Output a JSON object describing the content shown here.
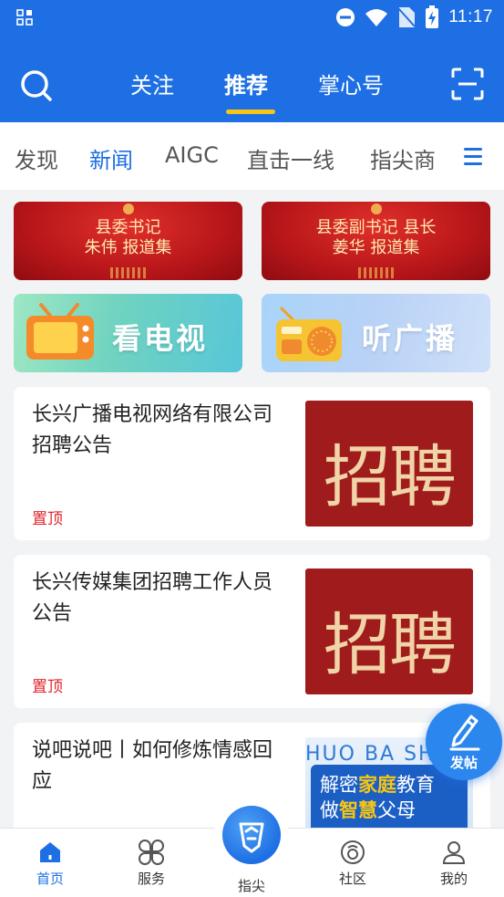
{
  "status_bar": {
    "time": "11:17"
  },
  "top_tabs": [
    {
      "label": "关注"
    },
    {
      "label": "推荐",
      "active": true
    },
    {
      "label": "掌心号"
    }
  ],
  "channels": [
    {
      "label": "发现"
    },
    {
      "label": "新闻",
      "active": true
    },
    {
      "label": "AIGC"
    },
    {
      "label": "直击一线"
    },
    {
      "label": "指尖商"
    }
  ],
  "banners": {
    "secretary": {
      "line1": "县委书记",
      "line2": "朱伟 报道集"
    },
    "deputy": {
      "line1": "县委副书记 县长",
      "line2": "姜华 报道集"
    },
    "tv": {
      "label": "看电视"
    },
    "radio": {
      "label": "听广播"
    }
  },
  "articles": [
    {
      "title": "长兴广播电视网络有限公司招聘公告",
      "tag": "置顶",
      "thumb_text": "招聘"
    },
    {
      "title": "长兴传媒集团招聘工作人员公告",
      "tag": "置顶",
      "thumb_text": "招聘"
    },
    {
      "title": "说吧说吧丨如何修炼情感回应",
      "thumb_header": "HUO BA SHU",
      "thumb_poster_a": "解密",
      "thumb_poster_b": "家庭",
      "thumb_poster_c": "教育",
      "thumb_poster_d": "做",
      "thumb_poster_e": "智慧",
      "thumb_poster_f": "父母"
    }
  ],
  "fab": {
    "label": "发帖"
  },
  "bottom_nav": [
    {
      "label": "首页",
      "active": true
    },
    {
      "label": "服务"
    },
    {
      "label": "指尖"
    },
    {
      "label": "社区"
    },
    {
      "label": "我的"
    }
  ],
  "colors": {
    "brand_blue": "#1e6fe3",
    "accent_yellow": "#f7c614",
    "pin_red": "#e0242b"
  }
}
